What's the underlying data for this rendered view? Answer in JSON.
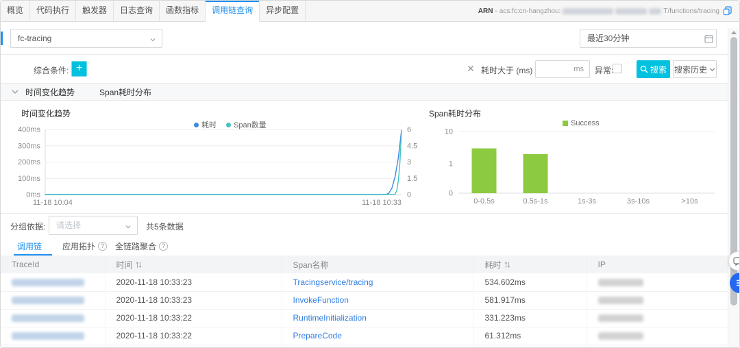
{
  "tabs": {
    "items": [
      {
        "label": "概览",
        "active": false
      },
      {
        "label": "代码执行",
        "active": false
      },
      {
        "label": "触发器",
        "active": false
      },
      {
        "label": "日志查询",
        "active": false
      },
      {
        "label": "函数指标",
        "active": false
      },
      {
        "label": "调用链查询",
        "active": true
      },
      {
        "label": "异步配置",
        "active": false
      }
    ]
  },
  "arn": {
    "label": "ARN",
    "dash": "-",
    "prefix": "acs:fc:cn-hangzhou:",
    "suffix": "T/functions/tracing",
    "redacted": true
  },
  "toolbar": {
    "service_select": "fc-tracing",
    "time_range": "最近30分钟"
  },
  "filter": {
    "label": "综合条件:",
    "add_label": "+",
    "duration_label": "耗时大于 (ms)",
    "duration_unit": "ms",
    "duration_value": "",
    "error_label": "异常:",
    "error_checked": false,
    "search_label": "搜索",
    "history_label": "搜索历史"
  },
  "section": {
    "trend_title": "时间变化趋势",
    "dist_title": "Span耗时分布"
  },
  "chart_data": [
    {
      "type": "line",
      "title": "时间变化趋势",
      "x_start": "11-18 10:04",
      "x_end": "11-18 10:33",
      "left_axis": {
        "ticks": [
          "0ms",
          "100ms",
          "200ms",
          "300ms",
          "400ms"
        ],
        "lim": [
          0,
          400
        ],
        "unit": "ms"
      },
      "right_axis": {
        "ticks": [
          "0",
          "1.5",
          "3",
          "4.5",
          "6"
        ],
        "lim": [
          0,
          6
        ]
      },
      "grid": true,
      "legend_position": "top-center",
      "series": [
        {
          "name": "耗时",
          "axis": "left",
          "color": "#3e86e0",
          "points": [
            [
              0,
              0
            ],
            [
              0.955,
              0
            ],
            [
              0.964,
              7
            ],
            [
              0.973,
              40
            ],
            [
              0.982,
              110
            ],
            [
              0.991,
              224
            ],
            [
              1,
              396
            ]
          ]
        },
        {
          "name": "Span数量",
          "axis": "right",
          "color": "#45c2c5",
          "points": [
            [
              0,
              0
            ],
            [
              0.978,
              0
            ],
            [
              0.9824,
              0.05
            ],
            [
              0.9868,
              0.38
            ],
            [
              0.9912,
              1.27
            ],
            [
              0.9956,
              3.0
            ],
            [
              1,
              5.9
            ]
          ]
        }
      ]
    },
    {
      "type": "bar",
      "title": "Span耗时分布",
      "legend": [
        "Success"
      ],
      "bar_color": "#8ccb3f",
      "categories": [
        "0-0.5s",
        "0.5s-1s",
        "1s-3s",
        "3s-10s",
        ">10s"
      ],
      "values": [
        3,
        2,
        0,
        0,
        0
      ],
      "yticks": [
        "0",
        "1",
        "10"
      ],
      "scale": "log",
      "ylim": [
        0,
        10
      ]
    }
  ],
  "results": {
    "groupby_label": "分组依据:",
    "groupby_placeholder": "请选择",
    "count_text": "共5条数据",
    "tabs": [
      {
        "label": "调用链",
        "active": true,
        "help": false
      },
      {
        "label": "应用拓扑",
        "active": false,
        "help": true
      },
      {
        "label": "全链路聚合",
        "active": false,
        "help": true
      }
    ],
    "columns": [
      {
        "label": "TraceId",
        "sortable": false
      },
      {
        "label": "时间",
        "sortable": true
      },
      {
        "label": "Span名称",
        "sortable": false
      },
      {
        "label": "耗时",
        "sortable": true
      },
      {
        "label": "IP",
        "sortable": false
      }
    ],
    "rows": [
      {
        "traceid_redacted": true,
        "time": "2020-11-18 10:33:23",
        "span": "Tracingservice/tracing",
        "duration": "534.602ms",
        "ip_redacted": true
      },
      {
        "traceid_redacted": true,
        "time": "2020-11-18 10:33:23",
        "span": "InvokeFunction",
        "duration": "581.917ms",
        "ip_redacted": true
      },
      {
        "traceid_redacted": true,
        "time": "2020-11-18 10:33:22",
        "span": "RuntimeInitialization",
        "duration": "331.223ms",
        "ip_redacted": true
      },
      {
        "traceid_redacted": true,
        "time": "2020-11-18 10:33:22",
        "span": "PrepareCode",
        "duration": "61.312ms",
        "ip_redacted": true
      }
    ]
  },
  "colors": {
    "accent_cyan": "#00C1DE",
    "accent_blue": "#2090ef",
    "link_blue": "#2e7de4",
    "line_blue": "#3e86e0",
    "line_teal": "#45c2c5",
    "bar_green": "#8ccb3f",
    "float_blue": "#2468f2"
  }
}
